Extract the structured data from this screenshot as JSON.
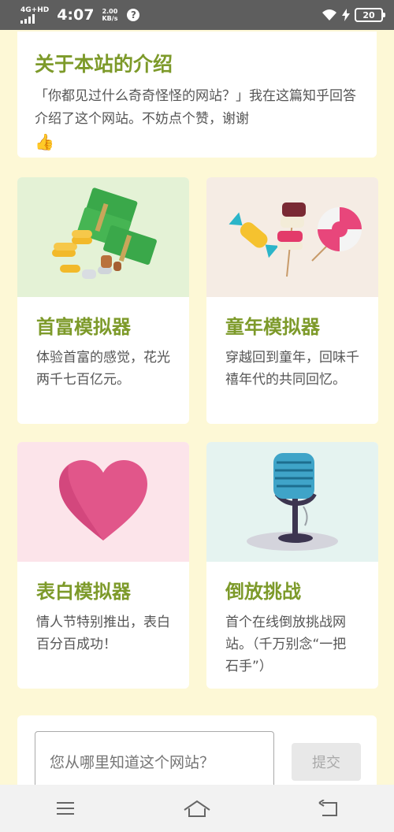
{
  "status_bar": {
    "network": "4G+HD",
    "time": "4:07",
    "speed_value": "2.00",
    "speed_unit": "KB/s",
    "battery": "20",
    "icons": [
      "signal-icon",
      "info-icon",
      "wifi-icon",
      "charging-icon",
      "battery-icon"
    ]
  },
  "intro": {
    "title": "关于本站的介绍",
    "description": "「你都见过什么奇奇怪怪的网站？」我在这篇知乎回答介绍了这个网站。不妨点个赞，谢谢",
    "emoji": "👍"
  },
  "tiles": [
    {
      "title": "首富模拟器",
      "description": "体验首富的感觉，花光两千七百亿元。",
      "icon": "money-stack-icon"
    },
    {
      "title": "童年模拟器",
      "description": "穿越回到童年，回味千禧年代的共同回忆。",
      "icon": "candy-icon"
    },
    {
      "title": "表白模拟器",
      "description": "情人节特别推出，表白百分百成功！",
      "icon": "heart-icon"
    },
    {
      "title": "倒放挑战",
      "description": "首个在线倒放挑战网站。（千万别念“一把石手”）",
      "icon": "microphone-icon"
    }
  ],
  "feedback": {
    "placeholder": "您从哪里知道这个网站？",
    "submit_label": "提交"
  },
  "colors": {
    "accent": "#7d9a2a",
    "background": "#fdf8d6"
  }
}
